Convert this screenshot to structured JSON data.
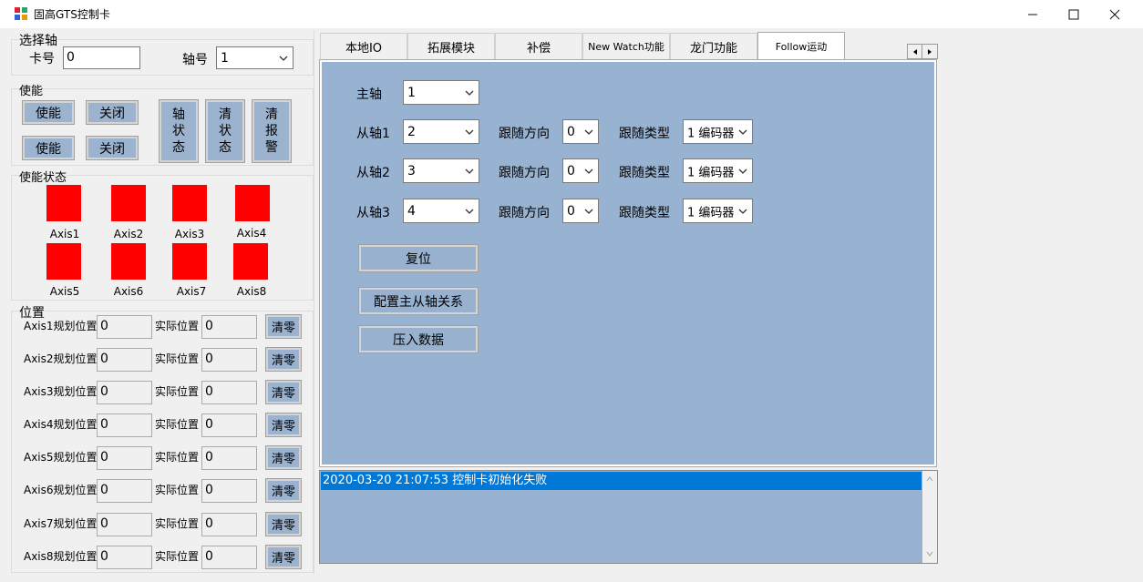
{
  "window": {
    "title": "固高GTS控制卡"
  },
  "select_axis": {
    "group_label": "选择轴",
    "card_label": "卡号",
    "card_value": "0",
    "axis_label": "轴号",
    "axis_value": "1"
  },
  "enable": {
    "group_label": "使能",
    "enable1": "使能",
    "close1": "关闭",
    "enable2": "使能",
    "close2": "关闭",
    "axis_status": [
      "轴",
      "状",
      "态"
    ],
    "clear_status": [
      "清",
      "状",
      "态"
    ],
    "clear_alarm": [
      "清",
      "报",
      "警"
    ]
  },
  "enable_status": {
    "group_label": "使能状态",
    "axes": [
      "Axis1",
      "Axis2",
      "Axis3",
      "Axis4",
      "Axis5",
      "Axis6",
      "Axis7",
      "Axis8"
    ],
    "indicator_color": "#ff0000"
  },
  "position": {
    "group_label": "位置",
    "actual_label": "实际位置",
    "clear_label": "清零",
    "rows": [
      {
        "label": "Axis1规划位置",
        "plan": "0",
        "actual": "0"
      },
      {
        "label": "Axis2规划位置",
        "plan": "0",
        "actual": "0"
      },
      {
        "label": "Axis3规划位置",
        "plan": "0",
        "actual": "0"
      },
      {
        "label": "Axis4规划位置",
        "plan": "0",
        "actual": "0"
      },
      {
        "label": "Axis5规划位置",
        "plan": "0",
        "actual": "0"
      },
      {
        "label": "Axis6规划位置",
        "plan": "0",
        "actual": "0"
      },
      {
        "label": "Axis7规划位置",
        "plan": "0",
        "actual": "0"
      },
      {
        "label": "Axis8规划位置",
        "plan": "0",
        "actual": "0"
      }
    ]
  },
  "tabs": [
    "本地IO",
    "拓展模块",
    "补偿",
    "New Watch功能",
    "龙门功能",
    "Follow运动"
  ],
  "active_tab": "Follow运动",
  "follow": {
    "master_label": "主轴",
    "master_value": "1",
    "dir_label": "跟随方向",
    "type_label": "跟随类型",
    "slaves": [
      {
        "label": "从轴1",
        "value": "2",
        "dir": "0",
        "type": "1 编码器"
      },
      {
        "label": "从轴2",
        "value": "3",
        "dir": "0",
        "type": "1 编码器"
      },
      {
        "label": "从轴3",
        "value": "4",
        "dir": "0",
        "type": "1 编码器"
      }
    ],
    "reset_button": "复位",
    "config_button": "配置主从轴关系",
    "push_button": "压入数据"
  },
  "log": {
    "entries": [
      "2020-03-20 21:07:53 控制卡初始化失败"
    ],
    "selected_color": "#0078d7"
  },
  "colors": {
    "panel": "#98b2d2",
    "button": "#9bb3cf"
  }
}
